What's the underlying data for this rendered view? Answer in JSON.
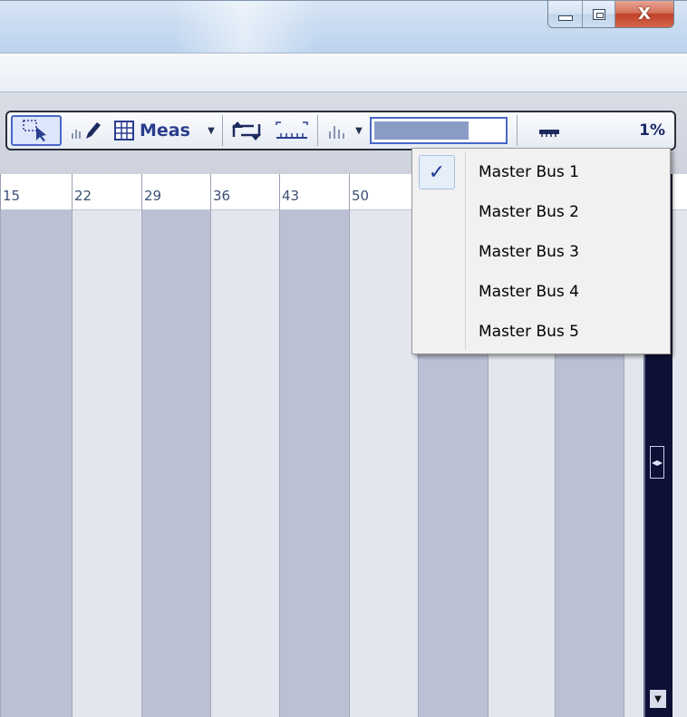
{
  "window": {
    "caption_buttons": [
      "minimize-icon",
      "maximize-icon",
      "close-icon"
    ],
    "close_glyph": "X"
  },
  "toolbar": {
    "snap_unit": "Meas",
    "zoom_percent": "1%",
    "level_meter": 0.73,
    "icons": [
      "select-tool-icon",
      "draw-tool-icon",
      "snap-grid-icon",
      "loop-icon",
      "ruler-icon",
      "bars-icon",
      "zoom-ruler-icon"
    ]
  },
  "timeline": {
    "ruler_ticks": [
      "15",
      "22",
      "29",
      "36",
      "43",
      "50"
    ]
  },
  "bus_menu": {
    "items": [
      {
        "label": "Master Bus 1",
        "checked": true
      },
      {
        "label": "Master Bus 2",
        "checked": false
      },
      {
        "label": "Master Bus 3",
        "checked": false
      },
      {
        "label": "Master Bus 4",
        "checked": false
      },
      {
        "label": "Master Bus 5",
        "checked": false
      }
    ],
    "check_glyph": "✓"
  },
  "colors": {
    "accent": "#4a66c8",
    "dark_column": "#bcc0d5",
    "light_column": "#e3e6ee",
    "scrollbar": "#0e1035"
  }
}
